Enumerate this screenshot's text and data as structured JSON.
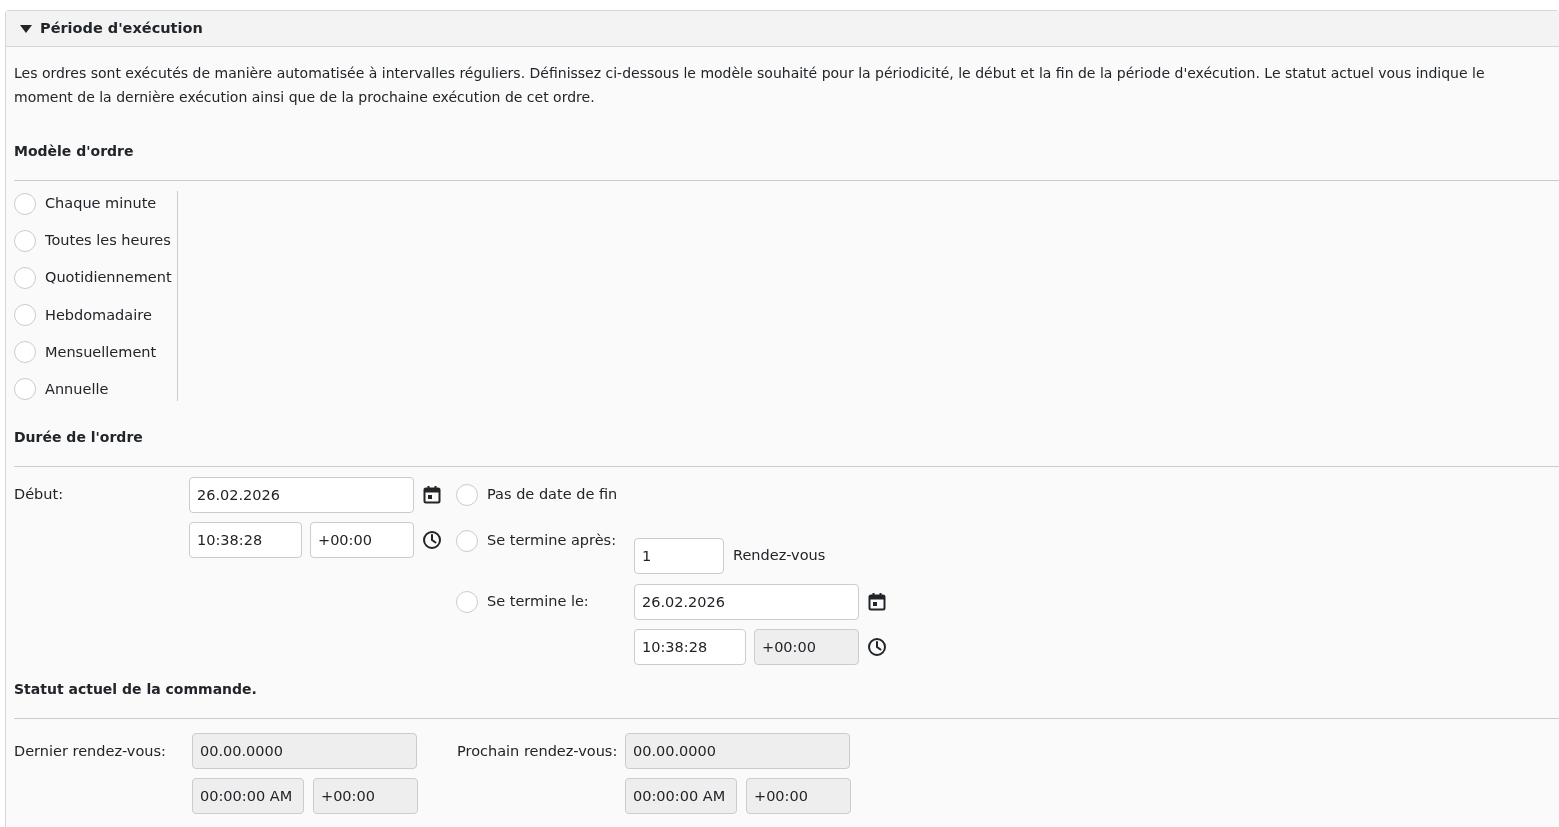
{
  "panel": {
    "title": "Période d'exécution",
    "expanded": true
  },
  "description": "Les ordres sont exécutés de manière automatisée à intervalles réguliers. Définissez ci-dessous le modèle souhaité pour la périodicité, le début et la fin de la période d'exécution. Le statut actuel vous indique le moment de la dernière exécution ainsi que de la prochaine exécution de cet ordre.",
  "pattern": {
    "heading": "Modèle d'ordre",
    "options": [
      {
        "label": "Chaque minute",
        "selected": false
      },
      {
        "label": "Toutes les heures",
        "selected": false
      },
      {
        "label": "Quotidiennement",
        "selected": false
      },
      {
        "label": "Hebdomadaire",
        "selected": false
      },
      {
        "label": "Mensuellement",
        "selected": false
      },
      {
        "label": "Annuelle",
        "selected": false
      }
    ]
  },
  "duration": {
    "heading": "Durée de l'ordre",
    "start": {
      "label": "Début:",
      "date": {
        "value": "26.02.2026",
        "disabled": false
      },
      "time": {
        "value": "10:38:28",
        "disabled": false
      },
      "timezone": {
        "value": "+00:00",
        "disabled": false
      }
    },
    "end_options": [
      {
        "kind": "none",
        "label": "Pas de date de fin",
        "selected": false
      },
      {
        "kind": "count",
        "label": "Se termine après:",
        "selected": false,
        "count": {
          "value": "1",
          "disabled": false
        },
        "unit": "Rendez-vous"
      },
      {
        "kind": "date",
        "label": "Se termine le:",
        "selected": false,
        "date": {
          "value": "26.02.2026",
          "disabled": false
        },
        "time": {
          "value": "10:38:28",
          "disabled": false
        },
        "timezone": {
          "value": "+00:00",
          "disabled": true
        }
      }
    ]
  },
  "status": {
    "heading": "**Statut actuel de la commande**.",
    "entries": [
      {
        "label": "Dernier rendez-vous:",
        "date": {
          "value": "00.00.0000",
          "disabled": true
        },
        "time": {
          "value": "00:00:00 AM",
          "disabled": true
        },
        "timezone": {
          "value": "+00:00",
          "disabled": true
        }
      },
      {
        "label": "Prochain rendez-vous:",
        "date": {
          "value": "00.00.0000",
          "disabled": true
        },
        "time": {
          "value": "00:00:00 AM",
          "disabled": true
        },
        "timezone": {
          "value": "+00:00",
          "disabled": true
        }
      }
    ]
  }
}
